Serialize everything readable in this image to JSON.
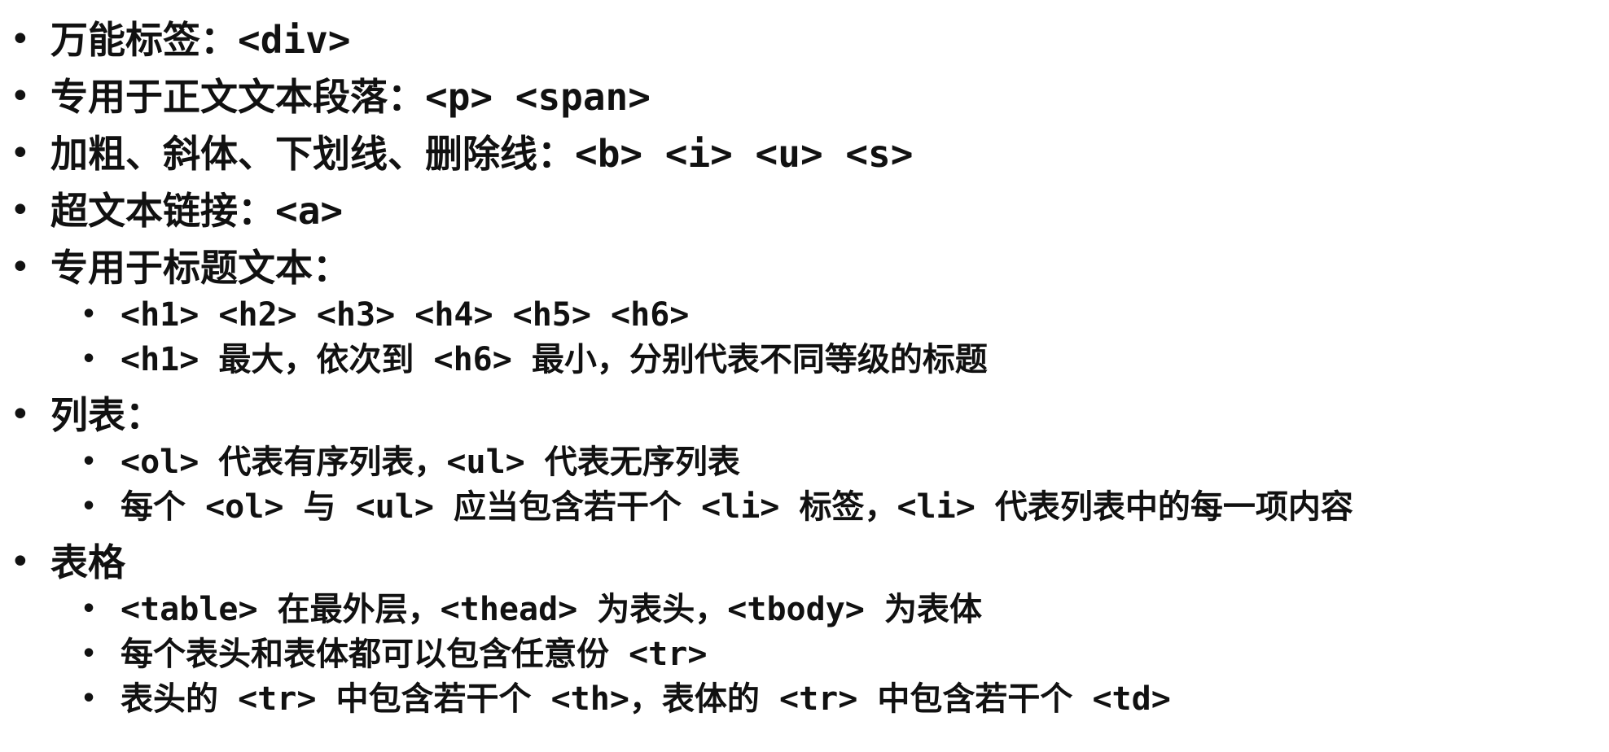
{
  "items": [
    {
      "text": "万能标签：<div>"
    },
    {
      "text": "专用于正文文本段落：<p> <span>"
    },
    {
      "text": "加粗、斜体、下划线、删除线：<b> <i> <u> <s>"
    },
    {
      "text": "超文本链接：<a>"
    },
    {
      "text": "专用于标题文本：",
      "subitems": [
        {
          "text": "<h1> <h2> <h3> <h4> <h5> <h6>"
        },
        {
          "text": "<h1> 最大，依次到 <h6> 最小，分别代表不同等级的标题"
        }
      ]
    },
    {
      "text": "列表：",
      "subitems": [
        {
          "text": "<ol> 代表有序列表，<ul> 代表无序列表"
        },
        {
          "text": "每个 <ol> 与 <ul> 应当包含若干个 <li> 标签，<li> 代表列表中的每一项内容"
        }
      ]
    },
    {
      "text": "表格",
      "subitems": [
        {
          "text": "<table> 在最外层，<thead> 为表头，<tbody> 为表体"
        },
        {
          "text": "每个表头和表体都可以包含任意份 <tr>"
        },
        {
          "text": "表头的 <tr> 中包含若干个 <th>，表体的 <tr> 中包含若干个 <td>"
        }
      ]
    }
  ],
  "bullet": "•"
}
